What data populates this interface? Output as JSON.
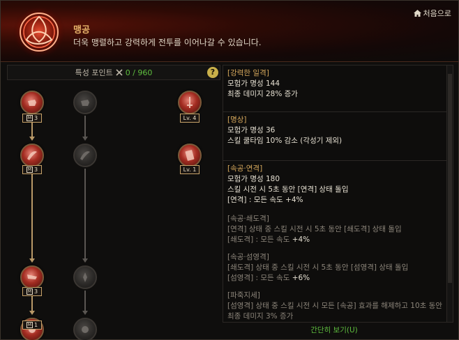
{
  "header": {
    "title": "맹공",
    "description": "더욱 맹렬하고 강력하게 전투를 이어나갈 수 있습니다.",
    "home_label": "처음으로"
  },
  "points": {
    "label": "특성 포인트",
    "value": "0 / 960",
    "help": "?"
  },
  "tree": {
    "nodes": [
      {
        "name": "node-col1-row1",
        "state": "active",
        "badge": "3",
        "badge_type": "M"
      },
      {
        "name": "node-col1-row2",
        "state": "active",
        "badge": "3",
        "badge_type": "M"
      },
      {
        "name": "node-col1-row3",
        "state": "active",
        "badge": "3",
        "badge_type": "M"
      },
      {
        "name": "node-col1-row4",
        "state": "active",
        "badge": "1",
        "badge_type": "M"
      },
      {
        "name": "node-col4-row1",
        "state": "active",
        "badge": "Lv. 4",
        "badge_type": "Lv"
      },
      {
        "name": "node-col4-row2",
        "state": "active",
        "badge": "Lv. 1",
        "badge_type": "Lv"
      }
    ]
  },
  "details": {
    "sections": [
      {
        "name": "[강력한 일격]",
        "fame": "모험가 명성 144",
        "effect": "최종 데미지 28% 증가"
      },
      {
        "name": "[명상]",
        "fame": "모험가 명성 36",
        "effect": "스킬 쿨타임 10% 감소 (각성기 제외)"
      },
      {
        "name": "[속공·연격]",
        "fame": "모험가 명성 180",
        "effect": "스킬 시전 시 5초 동안 [연격] 상태 돌입",
        "effect2_a": "[연격] : 모든 속도 ",
        "effect2_b": "+4%",
        "sub1_title": "[속공·쇄도격]",
        "sub1_line": "[연격] 상태 중 스킬 시전 시 5초 동안 [쇄도격] 상태 돌입",
        "sub1_eff_a": "[쇄도격] : 모든 속도 ",
        "sub1_eff_b": "+4%",
        "sub2_title": "[속공·섬영격]",
        "sub2_line": "[쇄도격] 상태 중 스킬 시전 시 5초 동안 [섬영격] 상태 돌입",
        "sub2_eff_a": "[섬영격] : 모든 속도 ",
        "sub2_eff_b": "+6%",
        "sub3_title": "[파죽지세]",
        "sub3_line": "[섬영격] 상태 중 스킬 시전 시 모든 [속공] 효과를 해제하고 10초 동안 최종 데미지 3% 증가"
      }
    ]
  },
  "footer": {
    "brief_label": "간단히 보기(U)"
  },
  "colors": {
    "accent": "#d6a85c",
    "green": "#5fbf3f",
    "header_red": "#5a1208"
  }
}
